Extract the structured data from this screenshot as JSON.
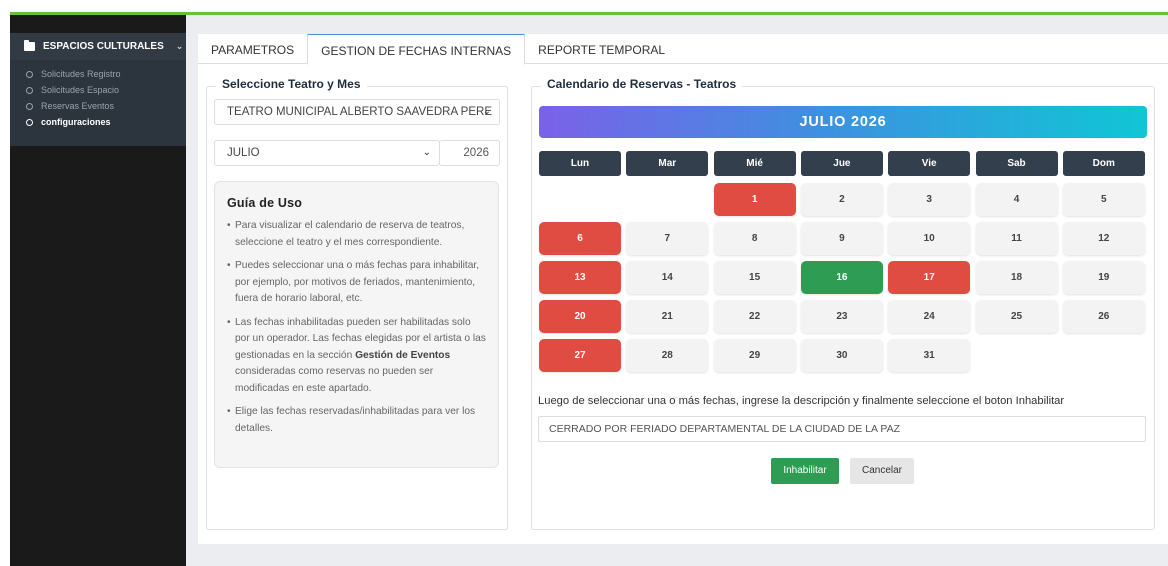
{
  "sidebar": {
    "section_title": "ESPACIOS CULTURALES",
    "items": [
      {
        "label": "Solicitudes Registro",
        "active": false
      },
      {
        "label": "Solicitudes Espacio",
        "active": false
      },
      {
        "label": "Reservas Eventos",
        "active": false
      },
      {
        "label": "configuraciones",
        "active": true
      }
    ]
  },
  "tabs": [
    {
      "label": "PARAMETROS",
      "active": false
    },
    {
      "label": "GESTION DE FECHAS INTERNAS",
      "active": true
    },
    {
      "label": "REPORTE TEMPORAL",
      "active": false
    }
  ],
  "left": {
    "legend": "Seleccione Teatro y Mes",
    "theatre_value": "TEATRO MUNICIPAL ALBERTO SAAVEDRA PERE",
    "month_value": "JULIO",
    "year_value": "2026",
    "guide_title": "Guía de Uso",
    "guide_items": [
      "Para visualizar el calendario de reserva de teatros, seleccione el teatro y el mes correspondiente.",
      "Puedes seleccionar una o más fechas para inhabilitar, por ejemplo, por motivos de feriados, mantenimiento, fuera de horario laboral, etc.",
      "Las fechas inhabilitadas pueden ser habilitadas solo por un operador. Las fechas elegidas por el artista o las gestionadas en la sección",
      "Elige las fechas reservadas/inhabilitadas para ver los detalles."
    ],
    "guide_item3_bold": "Gestión de Eventos",
    "guide_item3_tail": " consideradas como reservas no pueden ser modificadas en este apartado."
  },
  "calendar": {
    "legend": "Calendario de Reservas - Teatros",
    "month_title": "JULIO 2026",
    "weekdays": [
      "Lun",
      "Mar",
      "Mié",
      "Jue",
      "Vie",
      "Sab",
      "Dom"
    ],
    "first_weekday_index": 2,
    "days_in_month": 31,
    "red_days": [
      1,
      6,
      13,
      17,
      20,
      27
    ],
    "green_days": [
      16
    ],
    "colors": {
      "red": "#e04b42",
      "green": "#2e9c52",
      "header": "#333f4c"
    }
  },
  "form": {
    "hint": "Luego de seleccionar una o más fechas, ingrese la descripción y finalmente seleccione el boton Inhabilitar",
    "description_value": "CERRADO POR FERIADO DEPARTAMENTAL DE LA CIUDAD DE LA PAZ",
    "submit_label": "Inhabilitar",
    "cancel_label": "Cancelar"
  }
}
